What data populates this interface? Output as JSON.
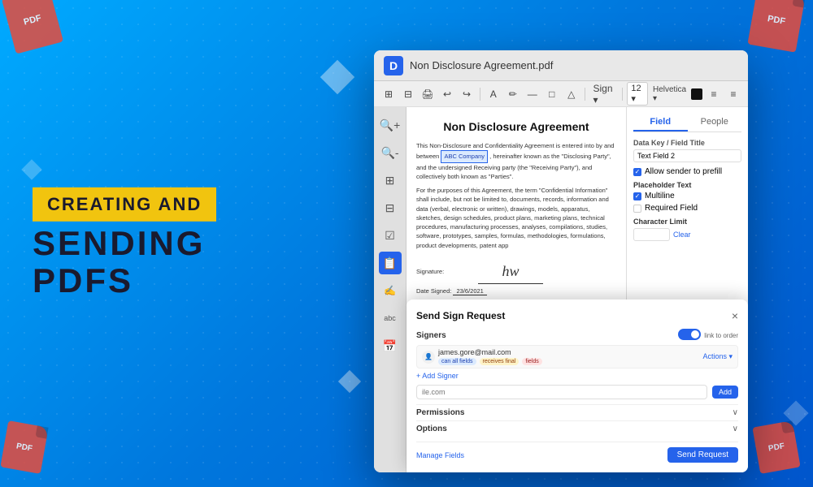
{
  "background": {
    "color": "#1a9fff"
  },
  "left_section": {
    "badge_text": "CREATING AND",
    "title_line1": "SENDING",
    "title_line2": "PDFS"
  },
  "pdf_window": {
    "title": "Non Disclosure Agreement.pdf",
    "logo_letter": "D",
    "toolbar": {
      "buttons": [
        "⊞",
        "⊟",
        "🖨",
        "↩",
        "↪",
        "A",
        "✏",
        "—",
        "—",
        "□",
        "△",
        "Sign ▾",
        "12 ▾",
        "Helvetica ▾",
        "■",
        "≡",
        "≡"
      ]
    },
    "sidebar_icons": [
      "🔍+",
      "🔍-",
      "⊞",
      "⊟",
      "☑",
      "📋",
      "✍",
      "abc",
      "📅"
    ],
    "document": {
      "title": "Non Disclosure Agreement",
      "paragraph1": "This Non-Disclosure and Confidentiality Agreement is entered into by and between",
      "highlight": "ABC Company",
      "paragraph1_cont": ", hereinafter known as the \"Disclosing Party\", and the undersigned Receiving party (the \"Receiving Party\"), and collectively both known as \"Parties\".",
      "paragraph2": "For the purposes of this Agreement, the term \"Confidential Information\" shall include, but not be limited to, documents, records, information and data (verbal, electronic or written), drawings, models, apparatus, sketches, design schedules, product plans, marketing plans, technical procedures, manufacturing processes, analyses, compilations, studies, software, prototypes, samples, formulas, methodologies, formulations, product developments, patent app",
      "signature_label": "Signature:",
      "signature_text": "hw",
      "date_label": "Date Signed:",
      "date_value": "23/6/2021"
    },
    "field_panel": {
      "tab_field": "Field",
      "tab_people": "People",
      "active_tab": "Field",
      "data_key_label": "Data Key / Field Title",
      "data_key_value": "Text Field 2",
      "allow_sender_label": "Allow sender to prefill",
      "placeholder_label": "Placeholder Text",
      "multiline_label": "Multiline",
      "required_label": "Required Field",
      "char_limit_label": "Character Limit",
      "clear_label": "Clear"
    }
  },
  "send_dialog": {
    "title": "Send Sign Request",
    "close_icon": "×",
    "signers_label": "Signers",
    "link_to_order_label": "link to order",
    "signer": {
      "email": "james.gore@mail.com",
      "actions_label": "Actions ▾",
      "pills": [
        "can all fields",
        "receives final",
        "fields"
      ]
    },
    "add_signer_label": "+ Add Signer",
    "email_placeholder": "ile.com",
    "add_label": "Add",
    "permissions_label": "Permissions",
    "options_label": "Options",
    "manage_fields_label": "Manage Fields",
    "send_request_label": "Send Request"
  }
}
